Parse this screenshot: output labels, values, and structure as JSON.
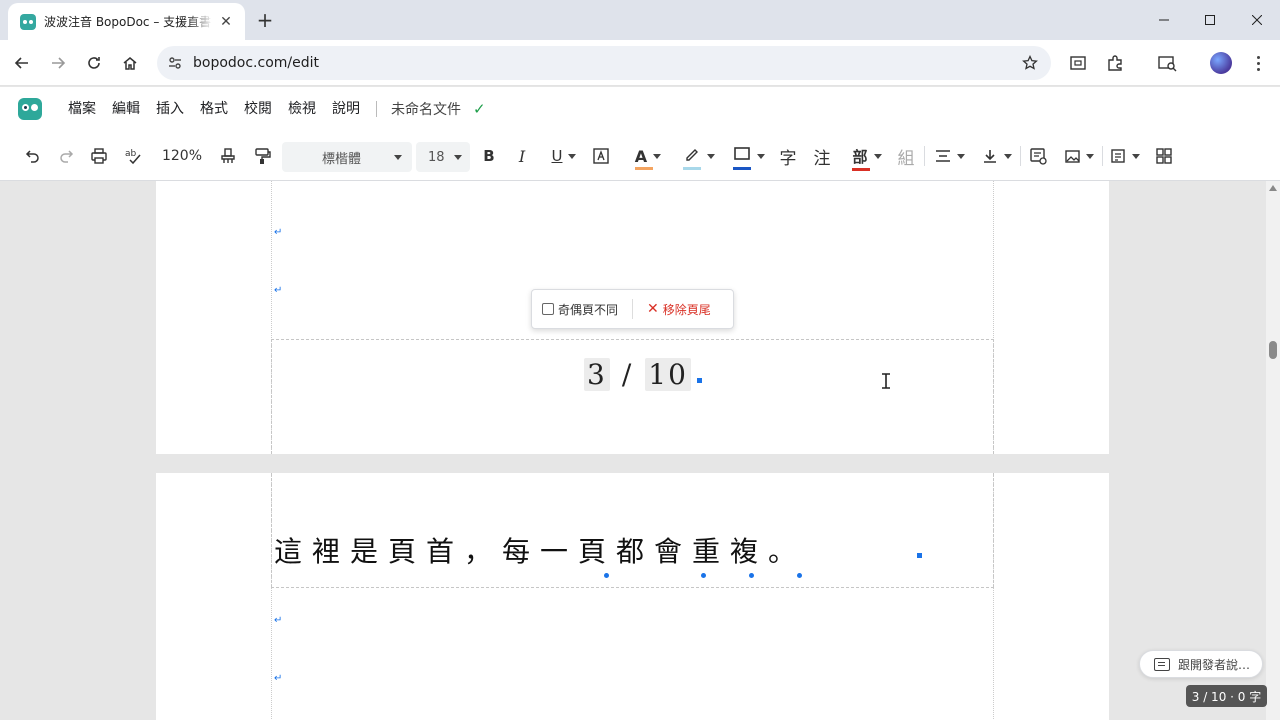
{
  "browser": {
    "tab_title": "波波注音 BopoDoc – 支援直書",
    "new_tab_label": "+",
    "url": "bopodoc.com/edit"
  },
  "menubar": {
    "items": [
      "檔案",
      "編輯",
      "插入",
      "格式",
      "校閱",
      "檢視",
      "說明"
    ],
    "doc_title": "未命名文件",
    "saved_mark": "✓"
  },
  "toolbar": {
    "zoom": "120%",
    "font": "標楷體",
    "font_size": "18",
    "bold": "B",
    "italic": "I",
    "underline": "U",
    "text_color": "A",
    "char_label": "字",
    "zhuyin_label": "注",
    "radical_label": "部",
    "compose_label": "組",
    "colors": {
      "text": "#f4a460",
      "highlight": "#a8d8ea",
      "border": "#1a56c4",
      "radical": "#d93025"
    }
  },
  "page1": {
    "page_num_current": "3",
    "page_num_slash": "/",
    "page_num_total": "10"
  },
  "footer_popup": {
    "odd_even_label": "奇偶頁不同",
    "remove_icon": "✕",
    "remove_label": "移除頁尾"
  },
  "page2": {
    "header_text": "這裡是頁首，每一頁都會重複。"
  },
  "feedback_label": "跟開發者說…",
  "status_text": "3 / 10 · 0 字"
}
